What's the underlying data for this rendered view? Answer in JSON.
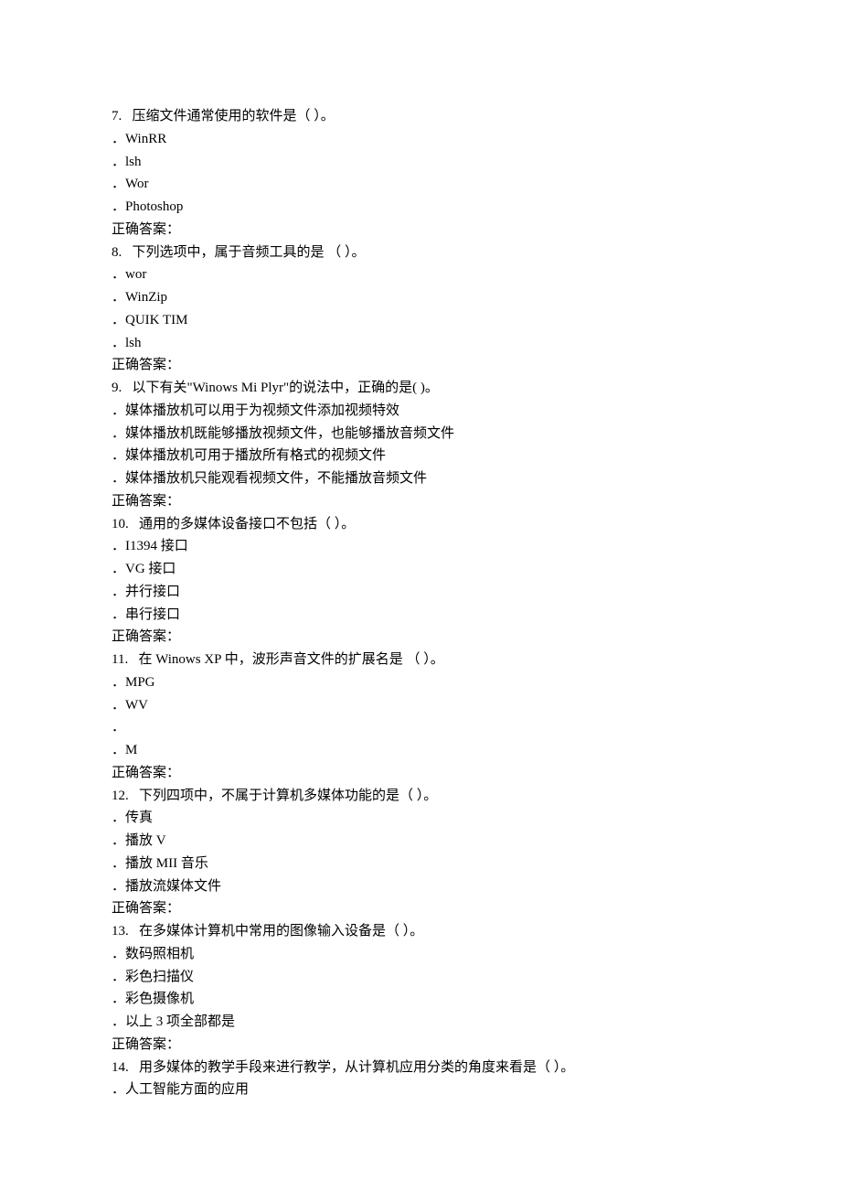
{
  "questions": [
    {
      "num": "7.",
      "text": "   压缩文件通常使用的软件是（ ）。",
      "options": [
        "．WinRR",
        "．lsh",
        "．Wor",
        "．Photoshop"
      ],
      "answer_label": "正确答案："
    },
    {
      "num": "8.",
      "text": "   下列选项中，属于音频工具的是 （ ）。",
      "options": [
        "．wor",
        "．WinZip",
        "．QUIK TIM",
        "．lsh"
      ],
      "answer_label": "正确答案："
    },
    {
      "num": "9.",
      "text": "   以下有关\"Winows Mi Plyr\"的说法中，正确的是( )。",
      "options": [
        "．媒体播放机可以用于为视频文件添加视频特效",
        "．媒体播放机既能够播放视频文件，也能够播放音频文件",
        "．媒体播放机可用于播放所有格式的视频文件",
        "．媒体播放机只能观看视频文件，不能播放音频文件"
      ],
      "answer_label": "正确答案："
    },
    {
      "num": "10.",
      "text": "   通用的多媒体设备接口不包括（ ）。",
      "options": [
        "．I1394 接口",
        "．VG 接口",
        "．并行接口",
        "．串行接口"
      ],
      "answer_label": "正确答案："
    },
    {
      "num": "11.",
      "text": "   在 Winows XP 中，波形声音文件的扩展名是 （ ）。",
      "options": [
        "．MPG",
        "．WV",
        "．",
        "．M"
      ],
      "answer_label": "正确答案："
    },
    {
      "num": "12.",
      "text": "   下列四项中，不属于计算机多媒体功能的是（ ）。",
      "options": [
        "．传真",
        "．播放 V",
        "．播放 MII 音乐",
        "．播放流媒体文件"
      ],
      "answer_label": "正确答案："
    },
    {
      "num": "13.",
      "text": "   在多媒体计算机中常用的图像输入设备是（ ）。",
      "options": [
        "．数码照相机",
        "．彩色扫描仪",
        "．彩色摄像机",
        "．以上 3 项全部都是"
      ],
      "answer_label": "正确答案："
    },
    {
      "num": "14.",
      "text": "   用多媒体的教学手段来进行教学，从计算机应用分类的角度来看是（ ）。",
      "options": [
        "．人工智能方面的应用"
      ],
      "answer_label": ""
    }
  ]
}
